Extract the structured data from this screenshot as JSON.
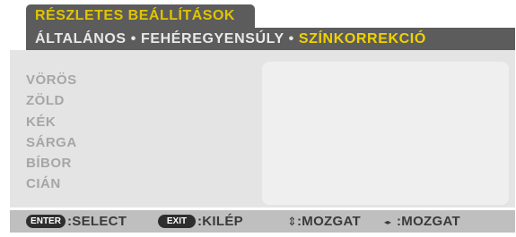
{
  "header": {
    "title": "RÉSZLETES BEÁLLÍTÁSOK",
    "breadcrumb": {
      "item1": "ÁLTALÁNOS",
      "item2": "FEHÉREGYENSÚLY",
      "item3": "SZÍNKORREKCIÓ",
      "separator": "•"
    }
  },
  "menu": {
    "items": [
      "VÖRÖS",
      "ZÖLD",
      "KÉK",
      "SÁRGA",
      "BÍBOR",
      "CIÁN"
    ]
  },
  "footer": {
    "enter_key": "ENTER",
    "enter_label": ":SELECT",
    "exit_key": "EXIT",
    "exit_label": ":KILÉP",
    "updown_icon": "⇕",
    "updown_label": ":MOZGAT",
    "leftright_icon": "◂▸",
    "leftright_label": ":MOZGAT"
  },
  "colors": {
    "title_text": "#e1c400",
    "active_crumb": "#f0d200",
    "header_bg": "#5c5c5c",
    "panel_bg": "#e4e4e4",
    "footer_bg": "#bfbfbf"
  }
}
